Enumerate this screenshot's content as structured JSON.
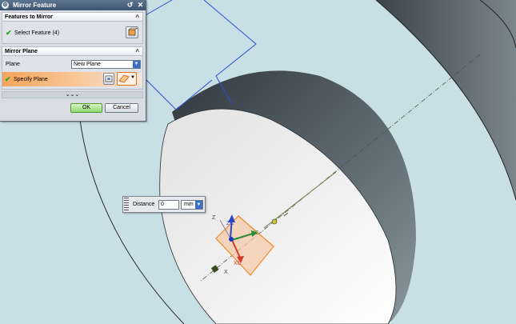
{
  "dialog": {
    "title": "Mirror Feature",
    "sections": {
      "features": {
        "header": "Features to Mirror",
        "select_label": "Select Feature (4)"
      },
      "plane": {
        "header": "Mirror Plane",
        "plane_label": "Plane",
        "plane_value": "New Plane",
        "specify_label": "Specify Plane"
      }
    },
    "more_glyph": "⌄⌄⌄",
    "ok_label": "OK",
    "cancel_label": "Cancel"
  },
  "handle": {
    "distance_label": "Distance",
    "distance_value": "0",
    "unit": "mm"
  },
  "triad": {
    "z_label": "Z",
    "zc_label": "ZC",
    "xc_label": "XC",
    "yc_label": "YC",
    "x_label": "X"
  },
  "colors": {
    "background": "#c9dfe6",
    "accent_orange": "#f08a2c",
    "check_green": "#29a329",
    "title_blue": "#3d546e"
  },
  "icons": [
    "gear-icon",
    "reset-icon",
    "close-icon",
    "check-icon",
    "select-feature-icon",
    "plane-dialog-icon",
    "specify-plane-icon",
    "chevron-down-icon"
  ]
}
